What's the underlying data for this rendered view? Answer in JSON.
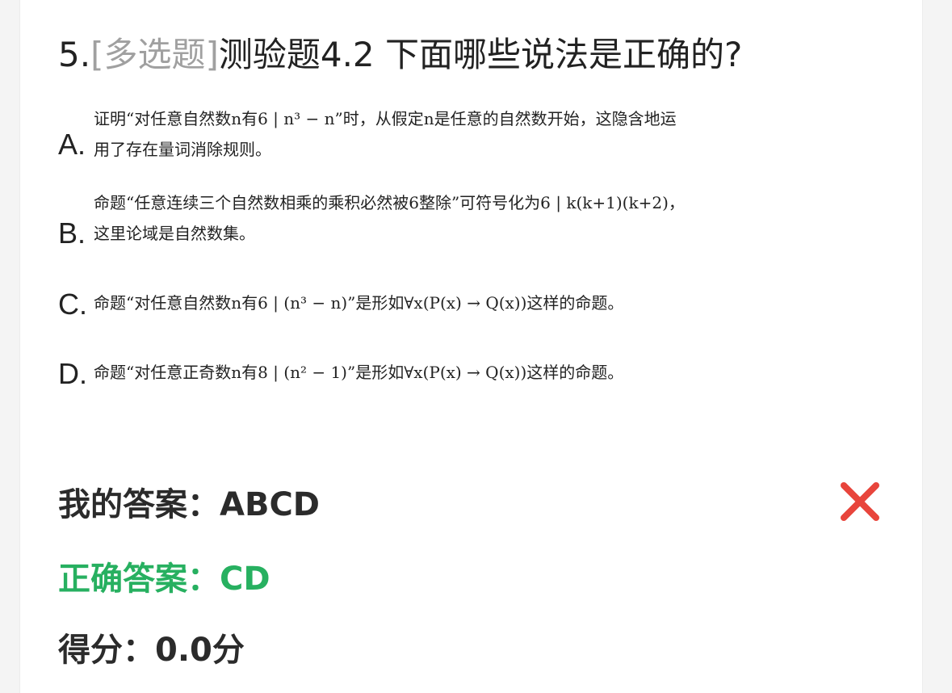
{
  "question": {
    "number": "5.",
    "type": "[多选题]",
    "text": "测验题4.2 下面哪些说法是正确的?"
  },
  "options": [
    {
      "letter": "A.",
      "line1": "证明“对任意自然数n有6 | n³ − n”时，从假定n是任意的自然数开始，这隐含地运",
      "line2": "用了存在量词消除规则。"
    },
    {
      "letter": "B.",
      "line1": "命题“任意连续三个自然数相乘的乘积必然被6整除”可符号化为6 | k(k+1)(k+2)，",
      "line2": "这里论域是自然数集。"
    },
    {
      "letter": "C.",
      "line1": "命题“对任意自然数n有6 | (n³ − n)”是形如∀x(P(x) → Q(x))这样的命题。"
    },
    {
      "letter": "D.",
      "line1": "命题“对任意正奇数n有8 | (n² − 1)”是形如∀x(P(x) → Q(x))这样的命题。"
    }
  ],
  "result": {
    "my_answer_label": "我的答案：",
    "my_answer_value": "ABCD",
    "correct_label": "正确答案：",
    "correct_value": "CD",
    "score_label": "得分：",
    "score_value": "0.0分"
  },
  "icons": {
    "wrong": "cross-icon"
  },
  "colors": {
    "correct": "#27b060",
    "wrong": "#e8453c",
    "type_tag": "#a0a0a0"
  }
}
